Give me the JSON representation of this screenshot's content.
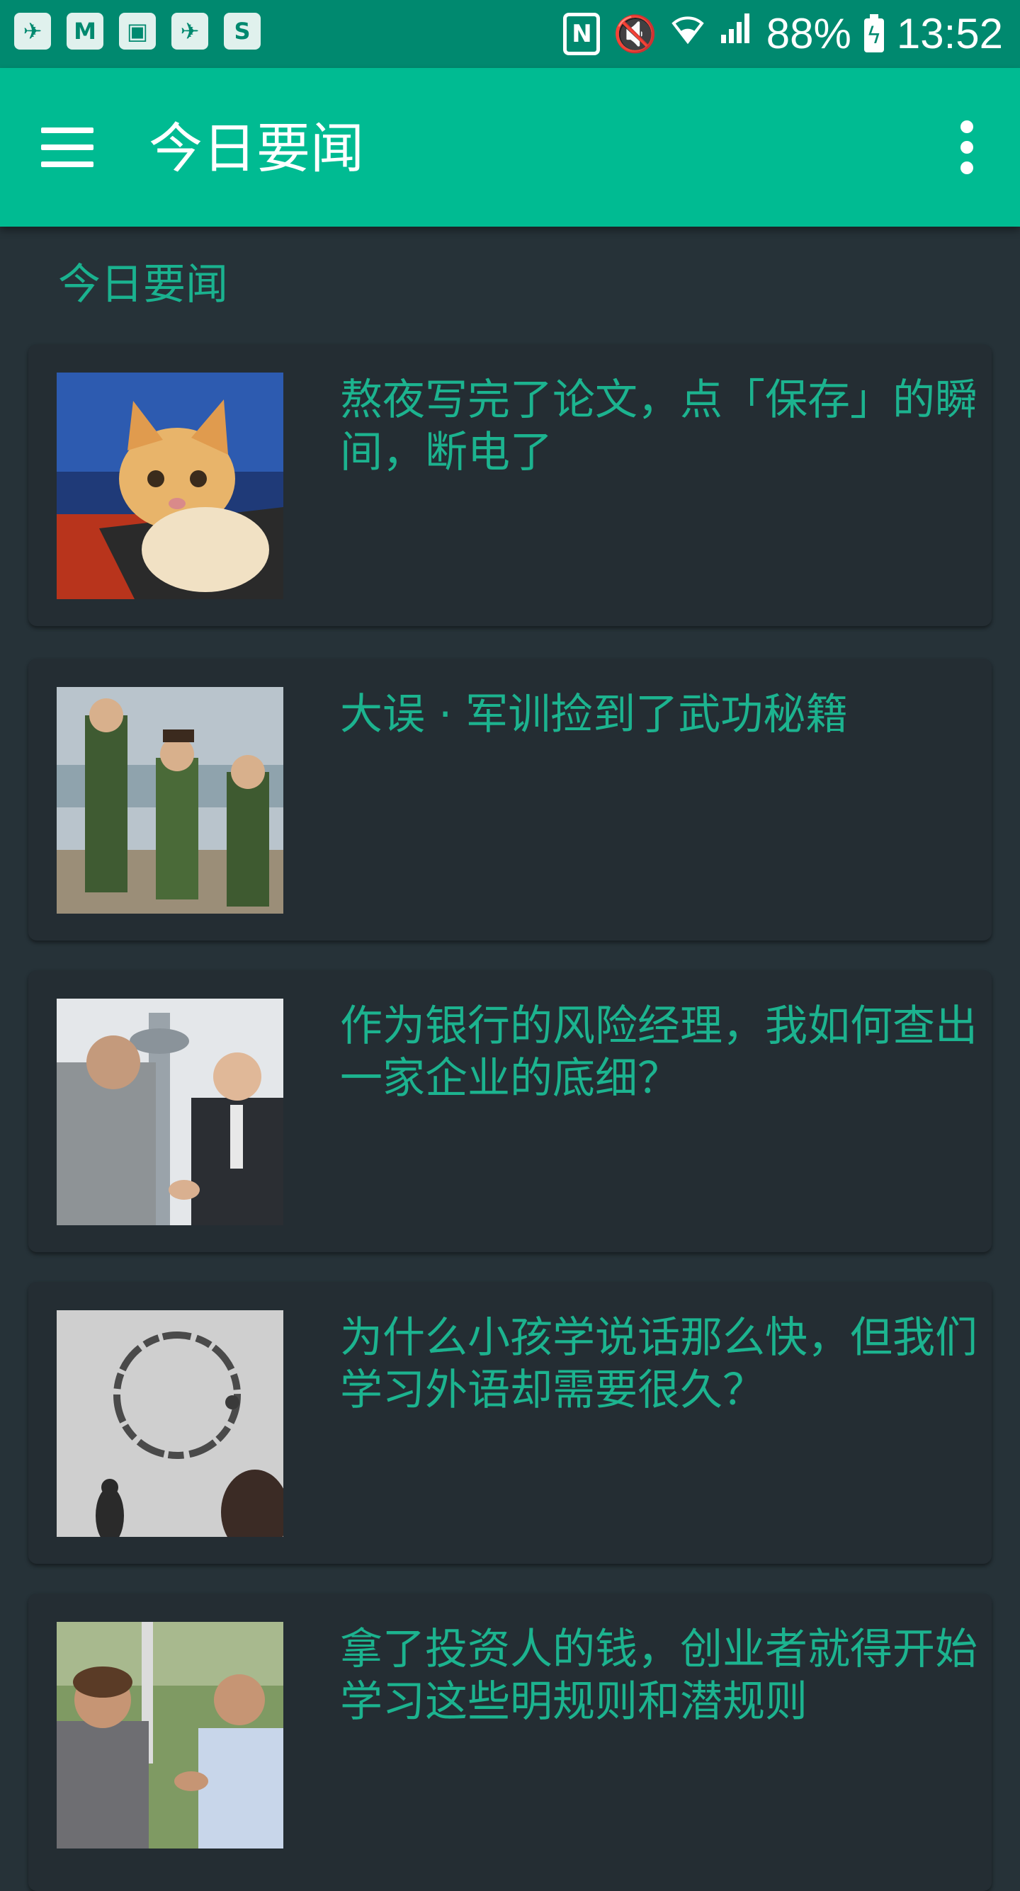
{
  "status_bar": {
    "notification_icons": [
      "app-notification-icon",
      "moji-weather-icon",
      "gallery-icon",
      "app-notification-icon",
      "skype-icon"
    ],
    "battery_percent": "88%",
    "time": "13:52"
  },
  "app_bar": {
    "title": "今日要闻",
    "menu_icon": "hamburger-menu-icon",
    "overflow_icon": "more-vert-icon"
  },
  "section": {
    "header": "今日要闻"
  },
  "stories": [
    {
      "title": "熬夜写完了论文，点「保存」的瞬间，断电了",
      "thumbnail": "kitten-on-laptop"
    },
    {
      "title": "大误 · 军训捡到了武功秘籍",
      "thumbnail": "military-training-students"
    },
    {
      "title": "作为银行的风险经理，我如何查出一家企业的底细？",
      "thumbnail": "handshake-worker-businessman"
    },
    {
      "title": "为什么小孩学说话那么快，但我们学习外语却需要很久？",
      "thumbnail": "arrival-alien-logogram"
    },
    {
      "title": "拿了投资人的钱，创业者就得开始学习这些明规则和潜规则",
      "thumbnail": "two-men-handshake-street"
    }
  ],
  "colors": {
    "status_bar": "#00896f",
    "app_bar": "#00bb92",
    "background": "#263238",
    "card": "#242d33",
    "accent_text": "#1cb38f"
  }
}
